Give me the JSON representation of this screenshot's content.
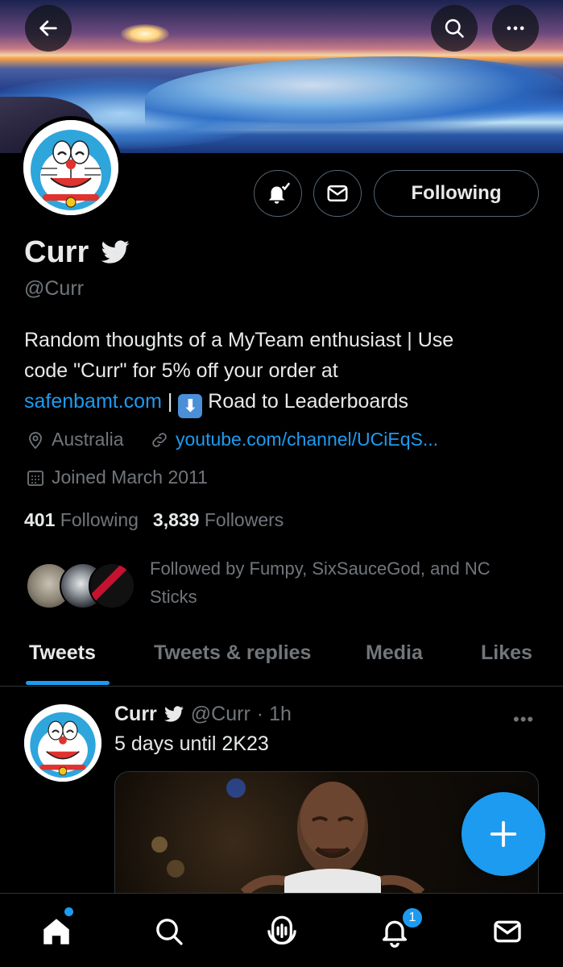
{
  "header": {
    "back_icon": "arrow-left-icon",
    "search_icon": "search-icon",
    "more_icon": "more-horizontal-icon"
  },
  "profile": {
    "name": "Curr",
    "verified_icon": "twitter-bird-icon",
    "handle": "@Curr",
    "bio_line1": "Random thoughts of a MyTeam enthusiast | Use",
    "bio_line2": "code \"Curr\" for 5% off your order at",
    "bio_link": "safenbamt.com",
    "bio_separator": " | ",
    "bio_emoji": "⬇",
    "bio_tail": " Road to Leaderboards",
    "location": "Australia",
    "website": "youtube.com/channel/UCiEqS...",
    "joined": "Joined March 2011",
    "following_count": "401",
    "following_label": "Following",
    "followers_count": "3,839",
    "followers_label": "Followers",
    "followed_by": "Followed by Fumpy, SixSauceGod, and NC Sticks"
  },
  "actions": {
    "notify_icon": "bell-check-icon",
    "message_icon": "mail-icon",
    "following_button": "Following"
  },
  "tabs": [
    {
      "label": "Tweets",
      "active": true
    },
    {
      "label": "Tweets & replies",
      "active": false
    },
    {
      "label": "Media",
      "active": false
    },
    {
      "label": "Likes",
      "active": false
    }
  ],
  "tweet": {
    "name": "Curr",
    "handle": "@Curr",
    "time": "· 1h",
    "text": "5 days until 2K23",
    "more": "•••"
  },
  "fab": {
    "icon": "plus-icon"
  },
  "nav": {
    "home_icon": "home-icon",
    "search_icon": "search-icon",
    "spaces_icon": "spaces-icon",
    "notifications_icon": "bell-icon",
    "notifications_badge": "1",
    "messages_icon": "mail-icon"
  },
  "colors": {
    "accent": "#1d9bf0",
    "muted": "#71767b",
    "text": "#e7e9ea",
    "border": "#2f3336"
  }
}
